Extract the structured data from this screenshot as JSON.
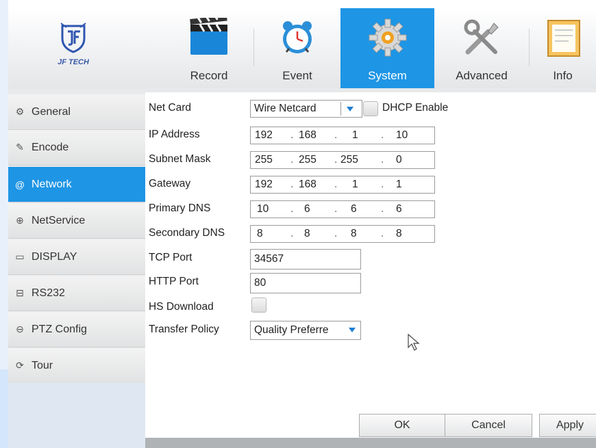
{
  "logo": {
    "text": "JF TECH"
  },
  "tabs": [
    {
      "label": "Record",
      "icon": "record-clapper-icon",
      "active": false
    },
    {
      "label": "Event",
      "icon": "alarm-clock-icon",
      "active": false
    },
    {
      "label": "System",
      "icon": "gear-icon",
      "active": true
    },
    {
      "label": "Advanced",
      "icon": "tools-icon",
      "active": false
    },
    {
      "label": "Info",
      "icon": "info-document-icon",
      "active": false
    }
  ],
  "sidebar": {
    "items": [
      {
        "label": "General",
        "icon": "general-gear-icon",
        "glyph": "⚙",
        "active": false
      },
      {
        "label": "Encode",
        "icon": "encode-icon",
        "glyph": "✎",
        "active": false
      },
      {
        "label": "Network",
        "icon": "at-sign-icon",
        "glyph": "@",
        "active": true
      },
      {
        "label": "NetService",
        "icon": "globe-icon",
        "glyph": "⊕",
        "active": false
      },
      {
        "label": "DISPLAY",
        "icon": "monitor-icon",
        "glyph": "▭",
        "active": false
      },
      {
        "label": "RS232",
        "icon": "serial-port-icon",
        "glyph": "⊟",
        "active": false
      },
      {
        "label": "PTZ Config",
        "icon": "ptz-icon",
        "glyph": "⊖",
        "active": false
      },
      {
        "label": "Tour",
        "icon": "tour-icon",
        "glyph": "⟳",
        "active": false
      }
    ]
  },
  "form": {
    "net_card": {
      "label": "Net Card",
      "value": "Wire Netcard"
    },
    "dhcp": {
      "label": "DHCP Enable",
      "checked": false
    },
    "ip_address": {
      "label": "IP Address",
      "octets": [
        "192",
        "168",
        "1",
        "10"
      ]
    },
    "subnet_mask": {
      "label": "Subnet Mask",
      "octets": [
        "255",
        "255",
        "255",
        "0"
      ]
    },
    "gateway": {
      "label": "Gateway",
      "octets": [
        "192",
        "168",
        "1",
        "1"
      ]
    },
    "primary_dns": {
      "label": "Primary DNS",
      "octets": [
        "10",
        "6",
        "6",
        "6"
      ]
    },
    "secondary_dns": {
      "label": "Secondary DNS",
      "octets": [
        "8",
        "8",
        "8",
        "8"
      ]
    },
    "tcp_port": {
      "label": "TCP Port",
      "value": "34567"
    },
    "http_port": {
      "label": "HTTP Port",
      "value": "80"
    },
    "hs_download": {
      "label": "HS Download",
      "checked": false
    },
    "transfer_policy": {
      "label": "Transfer Policy",
      "value": "Quality Preferre"
    }
  },
  "buttons": {
    "ok": "OK",
    "cancel": "Cancel",
    "apply": "Apply"
  },
  "colors": {
    "accent": "#1e95e5"
  }
}
